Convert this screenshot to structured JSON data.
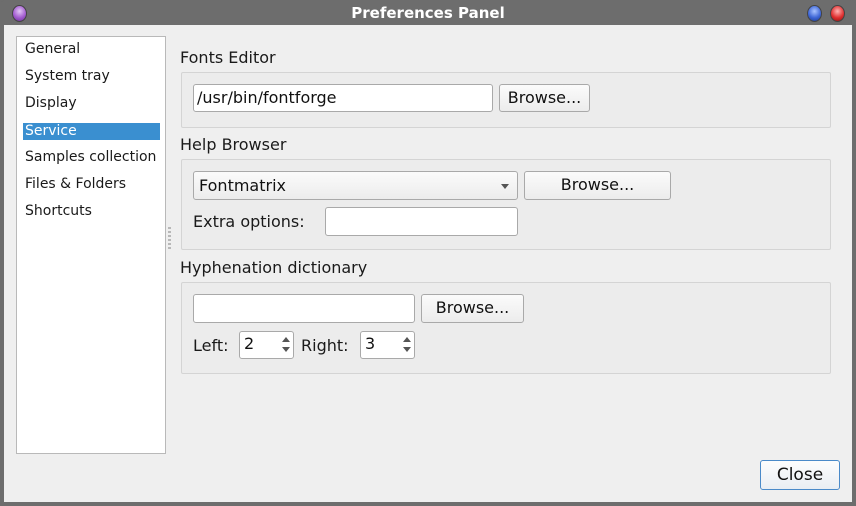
{
  "window": {
    "title": "Preferences Panel",
    "controls": {
      "menu": "window-menu-orb",
      "minimize": "minimize-orb",
      "close": "close-orb"
    }
  },
  "sidebar": {
    "items": [
      {
        "label": "General",
        "selected": false
      },
      {
        "label": "System tray",
        "selected": false
      },
      {
        "label": "Display",
        "selected": false
      },
      {
        "label": "Service",
        "selected": true
      },
      {
        "label": "Samples collection",
        "selected": false
      },
      {
        "label": "Files & Folders",
        "selected": false
      },
      {
        "label": "Shortcuts",
        "selected": false
      }
    ],
    "selected_color": "#3a8fd0"
  },
  "fonts_editor": {
    "title": "Fonts Editor",
    "path_value": "/usr/bin/fontforge",
    "browse_label": "Browse..."
  },
  "help_browser": {
    "title": "Help Browser",
    "selected_browser": "Fontmatrix",
    "browse_label": "Browse...",
    "extra_options_label": "Extra options:",
    "extra_options_value": ""
  },
  "hyphenation": {
    "title": "Hyphenation dictionary",
    "path_value": "",
    "browse_label": "Browse...",
    "left_label": "Left:",
    "left_value": "2",
    "right_label": "Right:",
    "right_value": "3"
  },
  "footer": {
    "close_label": "Close"
  }
}
